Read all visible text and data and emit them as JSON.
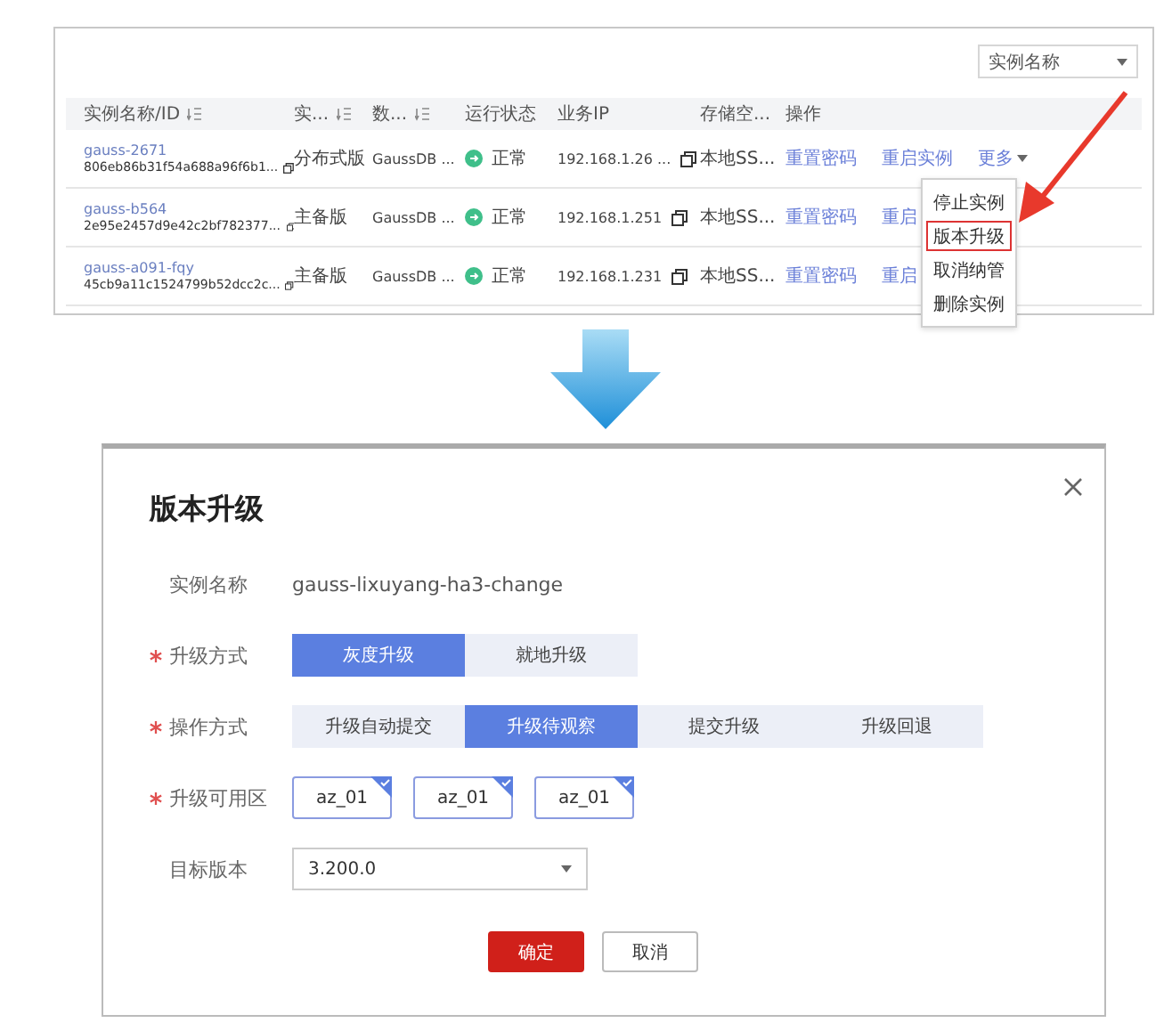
{
  "instance_list": {
    "filter_select": "实例名称",
    "columns": [
      {
        "label": "实例名称/ID",
        "sortable": true
      },
      {
        "label": "实...",
        "sortable": true
      },
      {
        "label": "数...",
        "sortable": true
      },
      {
        "label": "运行状态",
        "sortable": false
      },
      {
        "label": "业务IP",
        "sortable": false
      },
      {
        "label": "存储空...",
        "sortable": false
      },
      {
        "label": "操作",
        "sortable": false
      }
    ],
    "rows": [
      {
        "name": "gauss-2671",
        "id": "806eb86b31f54a688a96f6b1...",
        "type": "分布式版",
        "engine": "GaussDB ...",
        "status": "正常",
        "ip": "192.168.1.26 ...",
        "storage": "本地SS...",
        "actions": [
          {
            "label": "重置密码",
            "kind": "link"
          },
          {
            "label": "重启实例",
            "kind": "link"
          },
          {
            "label": "更多",
            "kind": "more"
          }
        ]
      },
      {
        "name": "gauss-b564",
        "id": "2e95e2457d9e42c2bf782377...",
        "type": "主备版",
        "engine": "GaussDB ...",
        "status": "正常",
        "ip": "192.168.1.251",
        "storage": "本地SS...",
        "actions": [
          {
            "label": "重置密码",
            "kind": "link"
          },
          {
            "label": "重启",
            "kind": "link"
          }
        ]
      },
      {
        "name": "gauss-a091-fqy",
        "id": "45cb9a11c1524799b52dcc2c...",
        "type": "主备版",
        "engine": "GaussDB ...",
        "status": "正常",
        "ip": "192.168.1.231",
        "storage": "本地SS...",
        "actions": [
          {
            "label": "重置密码",
            "kind": "link"
          },
          {
            "label": "重启",
            "kind": "link"
          }
        ]
      }
    ],
    "more_menu": [
      {
        "label": "停止实例",
        "highlighted": false
      },
      {
        "label": "版本升级",
        "highlighted": true
      },
      {
        "label": "取消纳管",
        "highlighted": false
      },
      {
        "label": "删除实例",
        "highlighted": false
      }
    ]
  },
  "dialog": {
    "title": "版本升级",
    "fields": [
      {
        "kind": "text",
        "label": "实例名称",
        "required": false,
        "value": "gauss-lixuyang-ha3-change"
      },
      {
        "kind": "segmented",
        "label": "升级方式",
        "required": true,
        "options": [
          {
            "label": "灰度升级",
            "selected": true
          },
          {
            "label": "就地升级",
            "selected": false
          }
        ]
      },
      {
        "kind": "segmented",
        "label": "操作方式",
        "required": true,
        "options": [
          {
            "label": "升级自动提交",
            "selected": false
          },
          {
            "label": "升级待观察",
            "selected": true
          },
          {
            "label": "提交升级",
            "selected": false
          },
          {
            "label": "升级回退",
            "selected": false
          }
        ]
      },
      {
        "kind": "chips",
        "label": "升级可用区",
        "required": true,
        "options": [
          {
            "label": "az_01",
            "selected": true
          },
          {
            "label": "az_01",
            "selected": true
          },
          {
            "label": "az_01",
            "selected": true
          }
        ]
      },
      {
        "kind": "select",
        "label": "目标版本",
        "required": false,
        "value": "3.200.0"
      }
    ],
    "buttons": [
      {
        "label": "确定",
        "kind": "primary"
      },
      {
        "label": "取消",
        "kind": "default"
      }
    ]
  }
}
